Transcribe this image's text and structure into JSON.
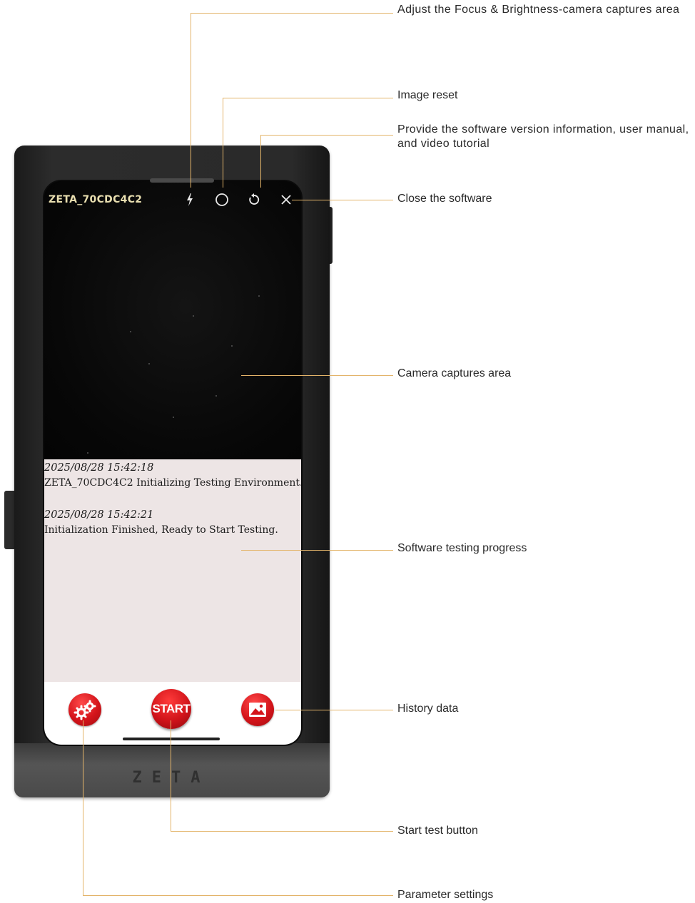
{
  "device": {
    "name": "ZETA_70CDC4C2",
    "brand_mark": "ZETA"
  },
  "toolbar": {
    "icons": [
      "flash-icon",
      "circle-icon",
      "reset-icon",
      "close-icon"
    ]
  },
  "log": {
    "entries": [
      {
        "time": "2025/08/28 15:42:18",
        "message": "ZETA_70CDC4C2 Initializing Testing Environment..."
      },
      {
        "time": "2025/08/28 15:42:21",
        "message": "Initialization Finished, Ready to Start Testing."
      }
    ]
  },
  "bottom_bar": {
    "start_label": "START",
    "settings_icon": "gears-icon",
    "history_icon": "image-icon"
  },
  "annotations": {
    "focus": "Adjust the Focus & Brightness-camera captures area",
    "reset": "Image reset",
    "info": "Provide the software version information, user manual, and video tutorial",
    "close": "Close the software",
    "camera": "Camera captures area",
    "progress": "Software testing progress",
    "history": "History data",
    "start": "Start test button",
    "settings": "Parameter settings"
  },
  "colors": {
    "accent_red": "#d4141a",
    "leader_line": "#e3b46a",
    "log_background": "#ede5e5",
    "device_name": "#e9dfb0"
  }
}
